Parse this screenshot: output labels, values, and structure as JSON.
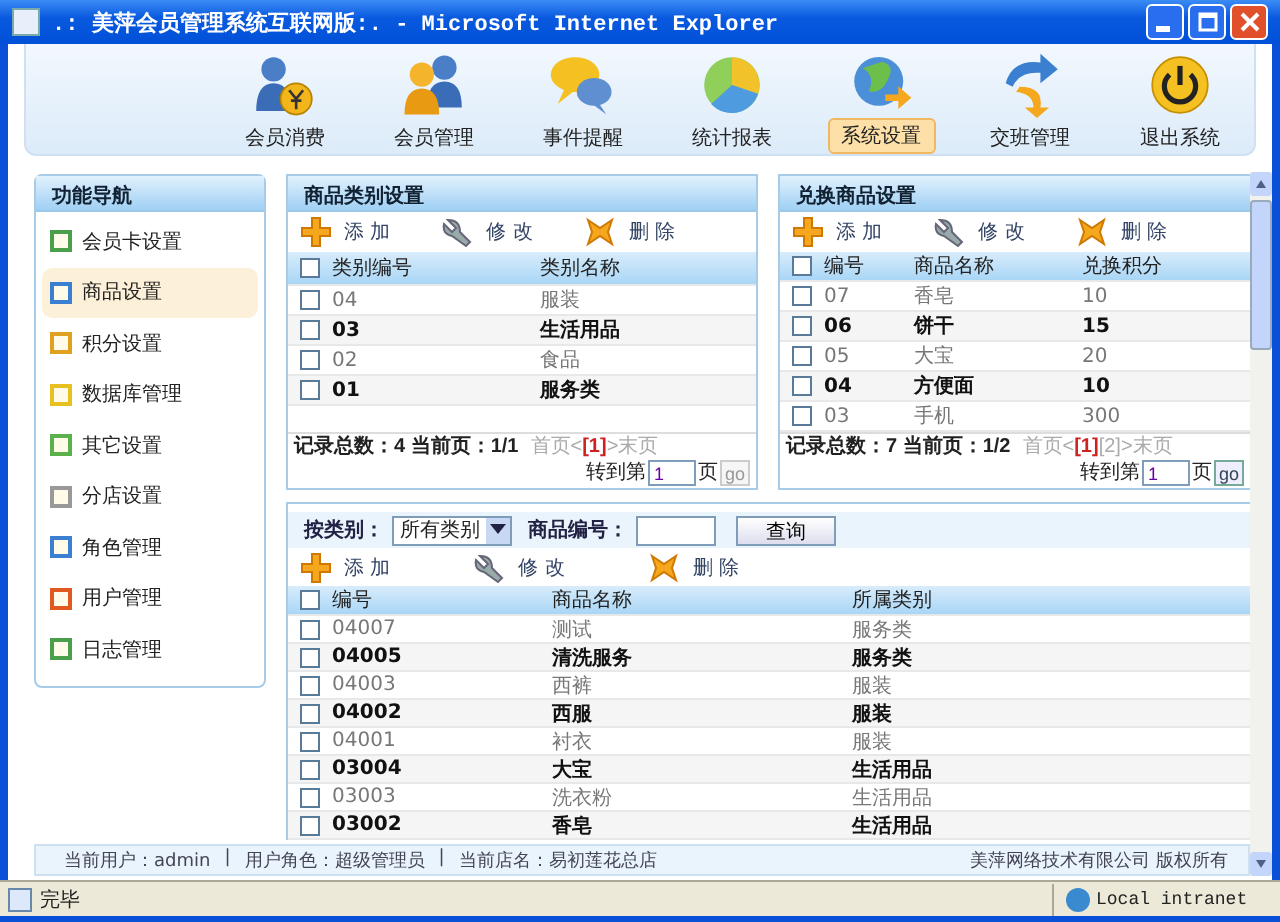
{
  "window": {
    "title": ".: 美萍会员管理系统互联网版:. - Microsoft Internet Explorer"
  },
  "top_nav": [
    {
      "label": "会员消费",
      "selected": false,
      "kind": "consume"
    },
    {
      "label": "会员管理",
      "selected": false,
      "kind": "members"
    },
    {
      "label": "事件提醒",
      "selected": false,
      "kind": "events"
    },
    {
      "label": "统计报表",
      "selected": false,
      "kind": "stats"
    },
    {
      "label": "系统设置",
      "selected": true,
      "kind": "system"
    },
    {
      "label": "交班管理",
      "selected": false,
      "kind": "shift"
    },
    {
      "label": "退出系统",
      "selected": false,
      "kind": "exit"
    }
  ],
  "sidebar": {
    "title": "功能导航",
    "items": [
      {
        "label": "会员卡设置",
        "selected": false
      },
      {
        "label": "商品设置",
        "selected": true
      },
      {
        "label": "积分设置",
        "selected": false
      },
      {
        "label": "数据库管理",
        "selected": false
      },
      {
        "label": "其它设置",
        "selected": false
      },
      {
        "label": "分店设置",
        "selected": false
      },
      {
        "label": "角色管理",
        "selected": false
      },
      {
        "label": "用户管理",
        "selected": false
      },
      {
        "label": "日志管理",
        "selected": false
      }
    ]
  },
  "category_panel": {
    "title": "商品类别设置",
    "toolbar": [
      "添 加",
      "修 改",
      "删 除"
    ],
    "columns": [
      "类别编号",
      "类别名称"
    ],
    "select_all_checked": false,
    "rows": [
      {
        "cells": [
          "04",
          "服装"
        ],
        "checked": false
      },
      {
        "cells": [
          "03",
          "生活用品"
        ],
        "checked": false
      },
      {
        "cells": [
          "02",
          "食品"
        ],
        "checked": false
      },
      {
        "cells": [
          "01",
          "服务类"
        ],
        "checked": false
      }
    ],
    "pager": {
      "summary": "记录总数：4 当前页：1/1",
      "links": [
        {
          "label": "首页<",
          "selected": false
        },
        {
          "label": "[1]",
          "selected": true
        },
        {
          "label": ">末页",
          "selected": false
        }
      ],
      "goto_label": "转到第",
      "goto_value": "1",
      "goto_unit": "页",
      "go": "go",
      "go_disabled": true
    }
  },
  "exchange_panel": {
    "title": "兑换商品设置",
    "toolbar": [
      "添 加",
      "修 改",
      "删 除"
    ],
    "columns": [
      "编号",
      "商品名称",
      "兑换积分"
    ],
    "select_all_checked": false,
    "rows": [
      {
        "cells": [
          "07",
          "香皂",
          "10"
        ],
        "checked": false
      },
      {
        "cells": [
          "06",
          "饼干",
          "15"
        ],
        "checked": false
      },
      {
        "cells": [
          "05",
          "大宝",
          "20"
        ],
        "checked": false
      },
      {
        "cells": [
          "04",
          "方便面",
          "10"
        ],
        "checked": false
      },
      {
        "cells": [
          "03",
          "手机",
          "300"
        ],
        "checked": false
      }
    ],
    "pager": {
      "summary": "记录总数：7 当前页：1/2",
      "links": [
        {
          "label": "首页<",
          "selected": false
        },
        {
          "label": "[1]",
          "selected": true
        },
        {
          "label": "[2]",
          "selected": false
        },
        {
          "label": ">末页",
          "selected": false
        }
      ],
      "goto_label": "转到第",
      "goto_value": "1",
      "goto_unit": "页",
      "go": "go",
      "go_disabled": false
    }
  },
  "goods_panel": {
    "filter": {
      "category_label": "按类别：",
      "category_value": "所有类别",
      "code_label": "商品编号：",
      "search_button": "查询"
    },
    "toolbar": [
      "添 加",
      "修 改",
      "删 除"
    ],
    "columns": [
      "编号",
      "商品名称",
      "所属类别"
    ],
    "select_all_checked": false,
    "rows": [
      {
        "cells": [
          "04007",
          "测试",
          "服务类"
        ],
        "checked": false
      },
      {
        "cells": [
          "04005",
          "清洗服务",
          "服务类"
        ],
        "checked": false
      },
      {
        "cells": [
          "04003",
          "西裤",
          "服装"
        ],
        "checked": false
      },
      {
        "cells": [
          "04002",
          "西服",
          "服装"
        ],
        "checked": false
      },
      {
        "cells": [
          "04001",
          "衬衣",
          "服装"
        ],
        "checked": false
      },
      {
        "cells": [
          "03004",
          "大宝",
          "生活用品"
        ],
        "checked": false
      },
      {
        "cells": [
          "03003",
          "洗衣粉",
          "生活用品"
        ],
        "checked": false
      },
      {
        "cells": [
          "03002",
          "香皂",
          "生活用品"
        ],
        "checked": false
      }
    ]
  },
  "footer": {
    "left": [
      "当前用户：admin",
      "|",
      "用户角色：超级管理员",
      "|",
      "当前店名：易初莲花总店"
    ],
    "right": "美萍网络技术有限公司 版权所有"
  },
  "status_bar": {
    "text": "完毕",
    "zone": "Local intranet"
  }
}
